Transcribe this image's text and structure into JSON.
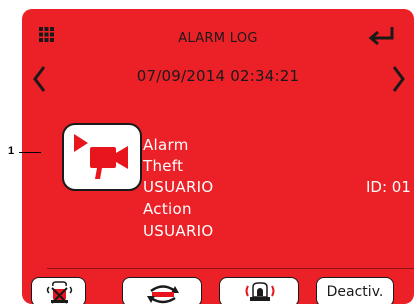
{
  "header": {
    "title": "ALARM LOG",
    "menu_icon": "grid-menu-icon",
    "enter_icon": "enter-return-icon"
  },
  "navigation": {
    "datetime": "07/09/2014 02:34:21",
    "prev_icon": "chevron-left-icon",
    "next_icon": "chevron-right-icon"
  },
  "callout": {
    "number": "1"
  },
  "event": {
    "icon": "video-camera-alarm-icon",
    "lines": [
      "Alarm",
      "Theft",
      "USUARIO",
      "Action",
      "USUARIO"
    ],
    "id_label": "ID: 01"
  },
  "footer": {
    "buttons": [
      {
        "icon": "siren-mute-icon"
      },
      {
        "icon": "reset-cycle-icon"
      },
      {
        "icon": "siren-alarm-icon"
      },
      {
        "label": "Deactiv."
      }
    ]
  },
  "colors": {
    "screen_bg": "#ec2027",
    "text_dark": "#1a1a1a",
    "text_light": "#ffffff",
    "icon_accent": "#e8151d"
  }
}
